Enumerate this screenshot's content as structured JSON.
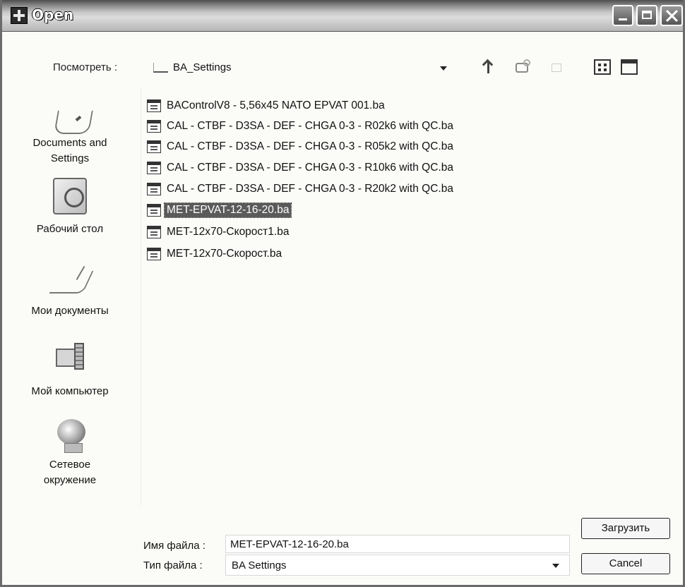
{
  "window": {
    "title": "Open"
  },
  "lookin": {
    "label": "Посмотреть :",
    "value": "BA_Settings"
  },
  "places": [
    {
      "label_lines": [
        "Documents and",
        "Settings"
      ],
      "icon": "documents-and-settings-icon"
    },
    {
      "label_lines": [
        "Рабочий стол"
      ],
      "icon": "desktop-icon"
    },
    {
      "label_lines": [
        "Мои документы"
      ],
      "icon": "my-documents-icon"
    },
    {
      "label_lines": [
        "Мой компьютер"
      ],
      "icon": "my-computer-icon"
    },
    {
      "label_lines": [
        "Сетевое",
        "окружение"
      ],
      "icon": "network-places-icon"
    }
  ],
  "files": [
    {
      "name": "BAControlV8 - 5,56x45 NATO EPVAT 001.ba",
      "selected": false
    },
    {
      "name": "CAL - CTBF - D3SA - DEF - CHGA 0-3 - R02k6 with QC.ba",
      "selected": false
    },
    {
      "name": "CAL - CTBF - D3SA - DEF - CHGA 0-3 - R05k2 with QC.ba",
      "selected": false
    },
    {
      "name": "CAL - CTBF - D3SA - DEF - CHGA 0-3 - R10k6 with QC.ba",
      "selected": false
    },
    {
      "name": "CAL - CTBF - D3SA - DEF - CHGA 0-3 - R20k2 with QC.ba",
      "selected": false
    },
    {
      "name": "MET-EPVAT-12-16-20.ba",
      "selected": true
    },
    {
      "name": "MET-12x70-Скорост1.ba",
      "selected": false
    },
    {
      "name": "MET-12x70-Скорост.ba",
      "selected": false
    }
  ],
  "filename": {
    "label": "Имя файла :",
    "value": "MET-EPVAT-12-16-20.ba"
  },
  "filetype": {
    "label": "Тип файла :",
    "value": "BA Settings"
  },
  "buttons": {
    "load": "Загрузить",
    "cancel": "Cancel"
  }
}
